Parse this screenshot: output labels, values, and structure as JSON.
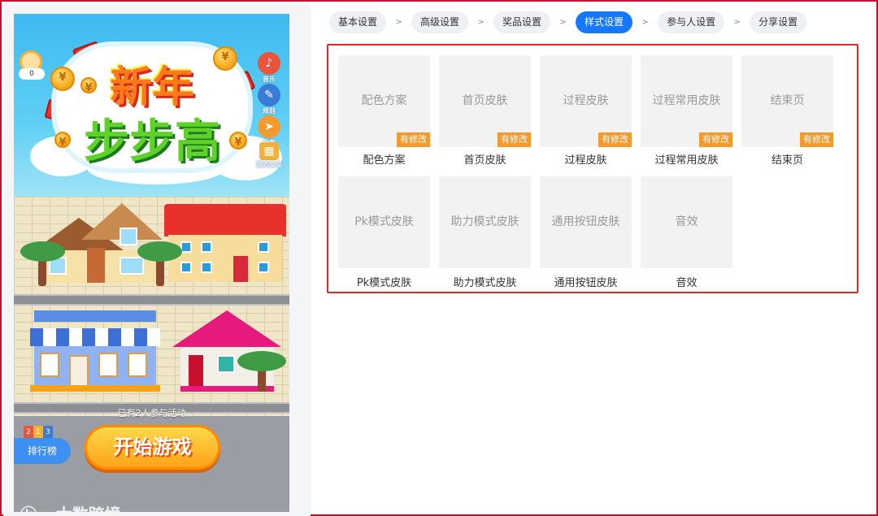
{
  "steps": [
    {
      "label": "基本设置",
      "active": false
    },
    {
      "label": "高级设置",
      "active": false
    },
    {
      "label": "奖品设置",
      "active": false
    },
    {
      "label": "样式设置",
      "active": true
    },
    {
      "label": "参与人设置",
      "active": false
    },
    {
      "label": "分享设置",
      "active": false
    }
  ],
  "step_separator": ">",
  "style_items": [
    {
      "thumb": "配色方案",
      "caption": "配色方案",
      "tag": "有修改"
    },
    {
      "thumb": "首页皮肤",
      "caption": "首页皮肤",
      "tag": "有修改"
    },
    {
      "thumb": "过程皮肤",
      "caption": "过程皮肤",
      "tag": "有修改"
    },
    {
      "thumb": "过程常用皮肤",
      "caption": "过程常用皮肤",
      "tag": "有修改"
    },
    {
      "thumb": "结束页",
      "caption": "结束页",
      "tag": "有修改"
    },
    {
      "thumb": "Pk模式皮肤",
      "caption": "Pk模式皮肤",
      "tag": ""
    },
    {
      "thumb": "助力模式皮肤",
      "caption": "助力模式皮肤",
      "tag": ""
    },
    {
      "thumb": "通用按钮皮肤",
      "caption": "通用按钮皮肤",
      "tag": ""
    },
    {
      "thumb": "音效",
      "caption": "音效",
      "tag": ""
    }
  ],
  "preview": {
    "title_line1": "新年",
    "title_line2": "步步高",
    "coin_count": "0",
    "side_buttons": [
      {
        "label": "音乐",
        "icon": "music-icon",
        "color": "#e8553a"
      },
      {
        "label": "规则",
        "icon": "rules-icon",
        "color": "#3a7bd5"
      },
      {
        "label": "分享",
        "icon": "share-icon",
        "color": "#f29a2e"
      },
      {
        "label": "我的奖品",
        "icon": "gift-icon",
        "color": "#f2b134"
      }
    ],
    "participants_text": "已有2人参与活动",
    "rank_label": "排行榜",
    "rank_digits": [
      "2",
      "1",
      "3"
    ],
    "start_label": "开始游戏",
    "watermark": "大数跨境"
  },
  "colors": {
    "accent": "#1677ff",
    "highlight_border": "#e3262b",
    "tag": "#f29a2e"
  }
}
